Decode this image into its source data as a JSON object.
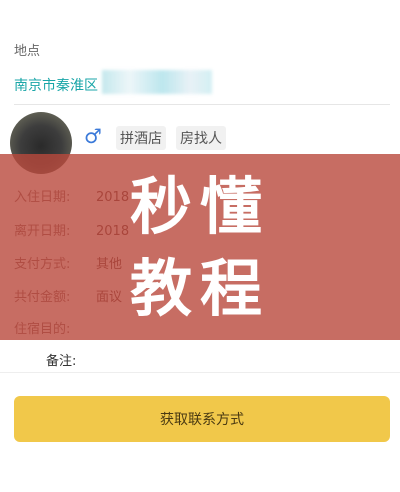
{
  "location": {
    "label": "地点",
    "address_visible": "南京市秦淮区"
  },
  "profile": {
    "gender_symbol": "♂",
    "tags": [
      "拼酒店",
      "房找人"
    ]
  },
  "details": [
    {
      "key": "入住日期:",
      "value": "2018"
    },
    {
      "key": "离开日期:",
      "value": "2018"
    },
    {
      "key": "支付方式:",
      "value": "其他"
    },
    {
      "key": "共付金额:",
      "value": "面议"
    },
    {
      "key": "住宿目的:",
      "value": ""
    }
  ],
  "note": {
    "label": "备注:"
  },
  "overlay": {
    "line1": "秒懂",
    "line2": "教程"
  },
  "actions": {
    "contact_button": "获取联系方式"
  },
  "colors": {
    "accent_teal": "#1aa6a8",
    "button_yellow": "#f1c84a",
    "overlay_red": "#b9483c",
    "male_blue": "#3b7ad9"
  }
}
